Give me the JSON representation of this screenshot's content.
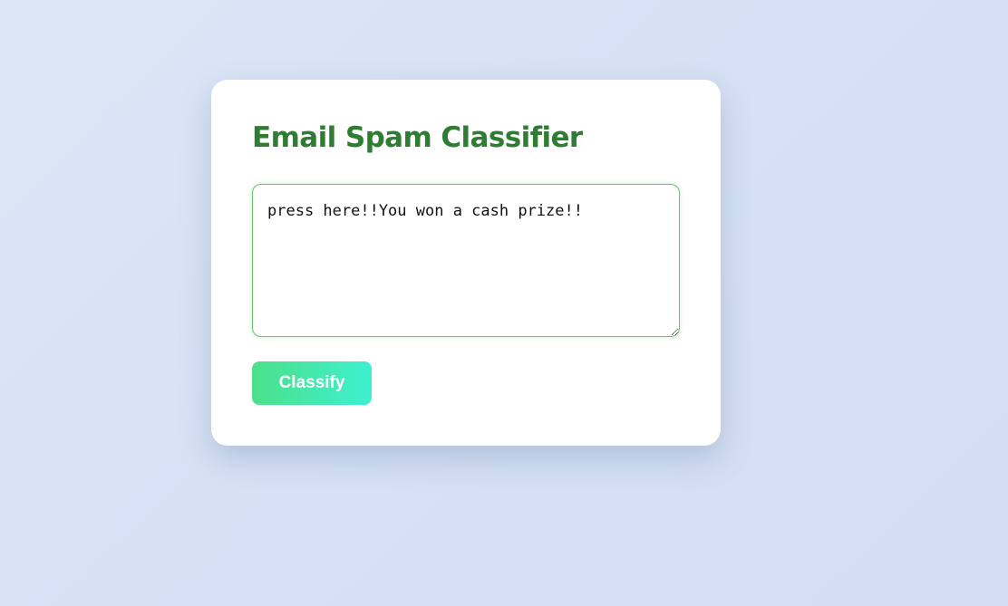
{
  "classifier": {
    "title": "Email Spam Classifier",
    "email_text": "press here!!You won a cash prize!!",
    "classify_label": "Classify"
  },
  "colors": {
    "title": "#2e7d32",
    "button_gradient_start": "#4ce08a",
    "button_gradient_end": "#3ef0d0",
    "textarea_border": "#6cc46f"
  }
}
